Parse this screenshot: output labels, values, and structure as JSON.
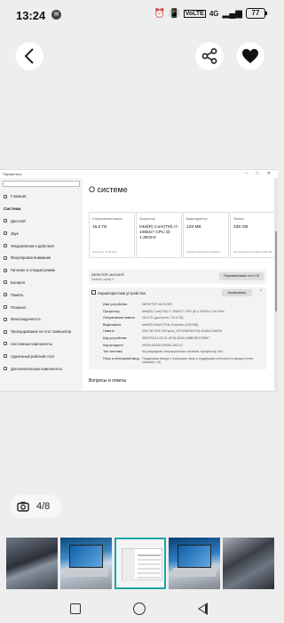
{
  "status_bar": {
    "time": "13:24",
    "network": "4G",
    "network_sub": "LTE",
    "volte": "VoLTE",
    "battery": "77"
  },
  "gallery": {
    "counter": "4/8"
  },
  "screenshot": {
    "window_title": "Параметры",
    "window_controls": "– □ ✕",
    "sidebar": {
      "home": "Главная",
      "section": "Система",
      "items": [
        "Дисплей",
        "Звук",
        "Уведомления и действия",
        "Фокусировка внимания",
        "Питание и спящий режим",
        "Батарея",
        "Память",
        "Планшет",
        "Многозадачность",
        "Проецирование на этот компьютер",
        "Системные компоненты",
        "Удаленный рабочий стол",
        "Дополнительные компоненты"
      ]
    },
    "title": "О системе",
    "cards": [
      {
        "label": "Оперативная память",
        "value": "16,0 ГБ",
        "sub": "Скорость: 3733 МГц"
      },
      {
        "label": "Процессор",
        "value": "Intel(R) Core(TM) i7-1065G7 CPU @ 1,30GHz",
        "sub": ""
      },
      {
        "label": "Видеоадаптер",
        "value": "128 MB",
        "sub": "Intel(R) Iris(R) Plus Graphics"
      },
      {
        "label": "Память",
        "value": "238 GB",
        "sub": "Используется 21 GB из 238 GB"
      }
    ],
    "device": {
      "name": "DESKTOP-AUSXKR",
      "model": "Surface Laptop 3",
      "rename_button": "Переименовать этот ПК"
    },
    "spec_header": "Характеристики устройства",
    "copy_button": "Копировать",
    "specs": [
      {
        "key": "Имя устройства",
        "value": "DESKTOP-AUSXKR"
      },
      {
        "key": "Процессор",
        "value": "Intel(R) Core(TM) i7-1065G7 CPU @ 1.30GHz 1.50 GHz"
      },
      {
        "key": "Оперативная память",
        "value": "16,0 ГБ (доступно: 15,6 ГБ)"
      },
      {
        "key": "Видеокарта",
        "value": "Intel(R) Iris(R) Plus Graphics (128 MB)"
      },
      {
        "key": "Память",
        "value": "238 GB SSD SKHynix_HFS256GD9TNI-62A0A 256GB"
      },
      {
        "key": "Код устройства",
        "value": "05DFE1D1-EC91-4F45-B309-1BBE3E1C5587"
      },
      {
        "key": "Код продукта",
        "value": "00330-80000-00000-AA213"
      },
      {
        "key": "Тип системы",
        "value": "64-разрядная операционная система, процессор x64"
      },
      {
        "key": "Перо и сенсорный ввод",
        "value": "Поддержка ввода с помощью пера и поддержка сенсорного ввода (точек касания: 10)"
      }
    ],
    "qa_title": "Вопросы и ответы"
  }
}
